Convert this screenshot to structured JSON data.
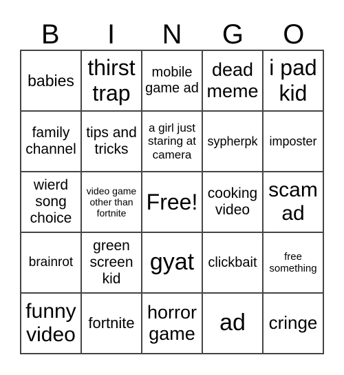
{
  "header": [
    "B",
    "I",
    "N",
    "G",
    "O"
  ],
  "cells": [
    "babies",
    "thirst trap",
    "mobile game ad",
    "dead meme",
    "i pad kid",
    "family channel",
    "tips and tricks",
    "a girl just staring at camera",
    "sypherpk",
    "imposter",
    "wierd song choice",
    "video game other than fortnite",
    "Free!",
    "cooking video",
    "scam ad",
    "brainrot",
    "green screen kid",
    "gyat",
    "clickbait",
    "free something",
    "funny video",
    "fortnite",
    "horror game",
    "ad",
    "cringe"
  ]
}
